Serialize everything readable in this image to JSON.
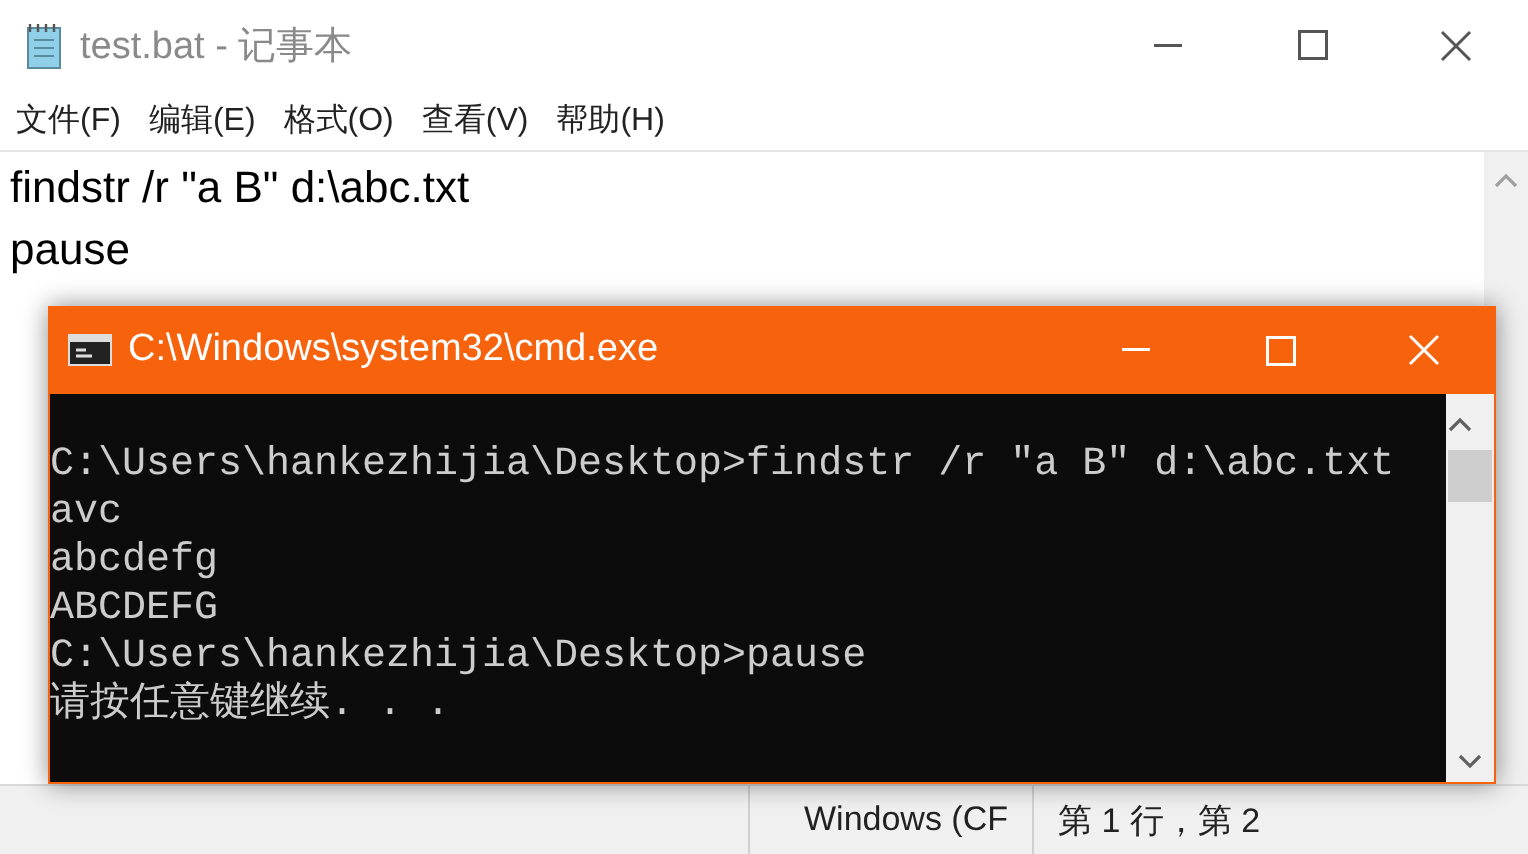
{
  "notepad": {
    "title": "test.bat - 记事本",
    "menu": [
      "文件(F)",
      "编辑(E)",
      "格式(O)",
      "查看(V)",
      "帮助(H)"
    ],
    "lines": [
      "findstr /r \"a B\" d:\\abc.txt",
      "pause"
    ],
    "status_bar": [
      "Windows (CF",
      "第 1 行，第 2"
    ]
  },
  "console": {
    "title": "C:\\Windows\\system32\\cmd.exe",
    "lines": [
      "C:\\Users\\hankezhijia\\Desktop>findstr /r \"a B\" d:\\abc.txt",
      "avc",
      "abcdefg",
      "ABCDEFG",
      "C:\\Users\\hankezhijia\\Desktop>pause",
      "请按任意键继续. . ."
    ]
  }
}
